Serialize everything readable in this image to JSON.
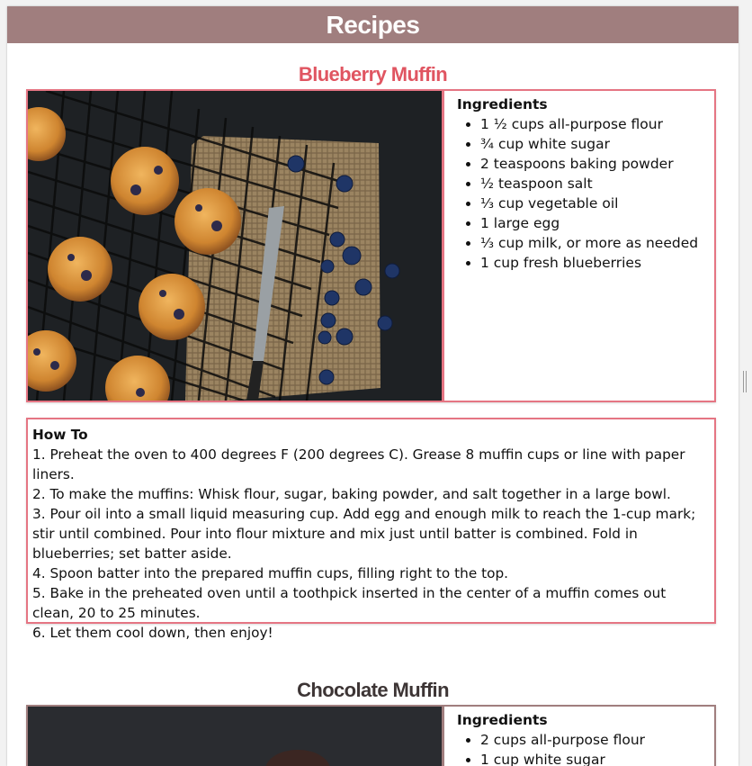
{
  "page": {
    "title": "Recipes"
  },
  "colors": {
    "header_bg": "#a07e7e",
    "accent_pink": "#e57583",
    "accent_mauve": "#a07e7e"
  },
  "recipes": [
    {
      "name": "Blueberry Muffin",
      "name_color": "#e05561",
      "image_icon": "blueberry-muffin-photo",
      "ingredients_heading": "Ingredients",
      "ingredients": [
        "1 ½ cups all-purpose flour",
        "¾ cup white sugar",
        "2 teaspoons baking powder",
        "½ teaspoon salt",
        "⅓ cup vegetable oil",
        "1 large egg",
        "⅓ cup milk, or more as needed",
        "1 cup fresh blueberries"
      ],
      "howto_heading": "How To",
      "steps": [
        "1. Preheat the oven to 400 degrees F (200 degrees C). Grease 8 muffin cups or line with paper liners.",
        "2. To make the muffins: Whisk flour, sugar, baking powder, and salt together in a large bowl.",
        "3. Pour oil into a small liquid measuring cup. Add egg and enough milk to reach the 1-cup mark; stir until combined. Pour into flour mixture and mix just until batter is combined. Fold in blueberries; set batter aside.",
        "4. Spoon batter into the prepared muffin cups, filling right to the top.",
        "5. Bake in the preheated oven until a toothpick inserted in the center of a muffin comes out clean, 20 to 25 minutes.",
        "6. Let them cool down, then enjoy!"
      ]
    },
    {
      "name": "Chocolate Muffin",
      "name_color": "#3d3535",
      "image_icon": "chocolate-muffin-photo",
      "ingredients_heading": "Ingredients",
      "ingredients": [
        "2 cups all-purpose flour",
        "1 cup white sugar"
      ]
    }
  ]
}
